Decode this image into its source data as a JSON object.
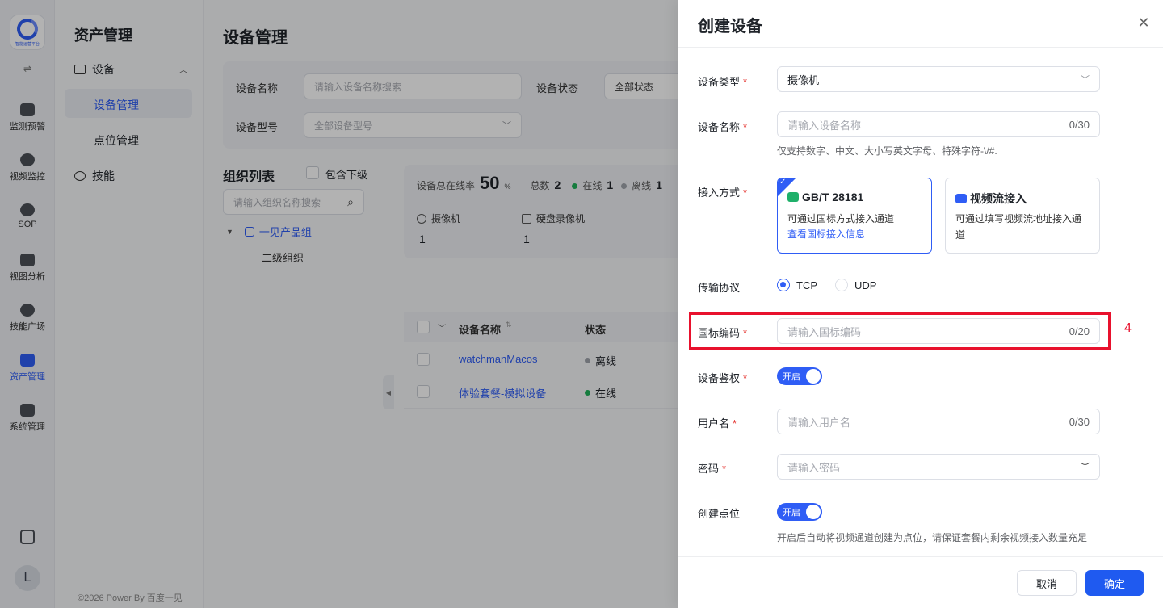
{
  "rail": {
    "logo_caption": "智能运营平台",
    "toggle": "⇌",
    "items": [
      {
        "label": "监测预警"
      },
      {
        "label": "视频监控"
      },
      {
        "label": "SOP"
      },
      {
        "label": "视图分析"
      },
      {
        "label": "技能广场"
      },
      {
        "label": "资产管理"
      },
      {
        "label": "系统管理"
      }
    ],
    "avatar": "L"
  },
  "subnav": {
    "title": "资产管理",
    "group": "设备",
    "items": [
      "设备管理",
      "点位管理"
    ],
    "skill": "技能",
    "copyright": "©2026 Power By 百度一见"
  },
  "main": {
    "title": "设备管理",
    "filters": {
      "name_label": "设备名称",
      "name_placeholder": "请输入设备名称搜索",
      "status_label": "设备状态",
      "status_value": "全部状态",
      "model_label": "设备型号",
      "model_value": "全部设备型号"
    },
    "org": {
      "title": "组织列表",
      "include_sub": "包含下级",
      "search_placeholder": "请输入组织名称搜索",
      "root": "一见产品组",
      "child": "二级组织"
    },
    "stats": {
      "online_rate_label": "设备总在线率",
      "online_rate": "50",
      "online_rate_unit": "%",
      "total_label": "总数",
      "total": "2",
      "online_label": "在线",
      "online": "1",
      "offline_label": "离线",
      "offline": "1",
      "camera_label": "摄像机",
      "camera_count": "1",
      "nvr_label": "硬盘录像机",
      "nvr_count": "1"
    },
    "table": {
      "col_name": "设备名称",
      "col_status": "状态",
      "rows": [
        {
          "name": "watchmanMacos",
          "status": "离线"
        },
        {
          "name": "体验套餐-模拟设备",
          "status": "在线"
        }
      ]
    }
  },
  "drawer": {
    "title": "创建设备",
    "device_type": {
      "label": "设备类型",
      "value": "摄像机"
    },
    "device_name": {
      "label": "设备名称",
      "placeholder": "请输入设备名称",
      "count": "0/30",
      "hint": "仅支持数字、中文、大小写英文字母、特殊字符-\\/#."
    },
    "access": {
      "label": "接入方式",
      "gb_title": "GB/T 28181",
      "gb_desc": "可通过国标方式接入通道",
      "gb_link": "查看国标接入信息",
      "stream_title": "视频流接入",
      "stream_desc": "可通过填写视频流地址接入通道"
    },
    "protocol": {
      "label": "传输协议",
      "tcp": "TCP",
      "udp": "UDP"
    },
    "gb_code": {
      "label": "国标编码",
      "placeholder": "请输入国标编码",
      "count": "0/20"
    },
    "auth": {
      "label": "设备鉴权",
      "switch": "开启"
    },
    "username": {
      "label": "用户名",
      "placeholder": "请输入用户名",
      "count": "0/30"
    },
    "password": {
      "label": "密码",
      "placeholder": "请输入密码"
    },
    "create_point": {
      "label": "创建点位",
      "switch": "开启",
      "hint": "开启后自动将视频通道创建为点位，请保证套餐内剩余视频接入数量充足"
    },
    "cancel": "取消",
    "confirm": "确定",
    "highlight_number": "4"
  },
  "colors": {
    "accent": "#2f5df5",
    "highlight": "#e8112d",
    "online": "#20b25a"
  }
}
